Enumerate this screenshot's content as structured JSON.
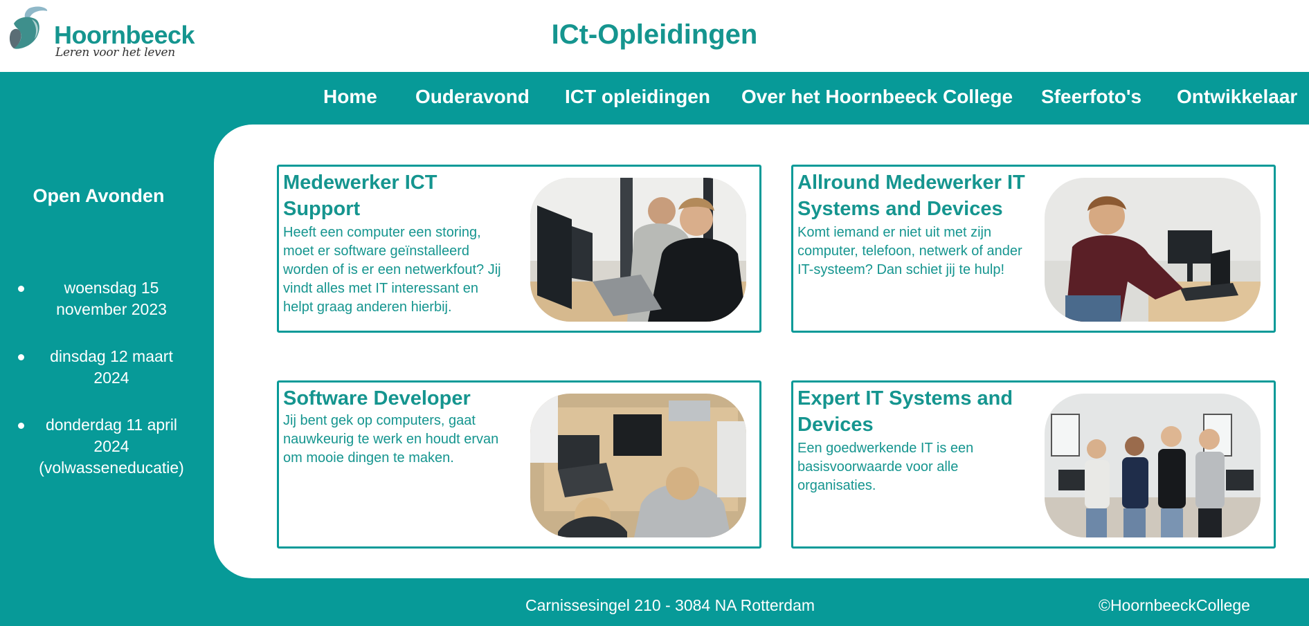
{
  "brand": {
    "name": "Hoornbeeck",
    "tagline": "Leren voor het leven",
    "accent_color": "#079a98",
    "heading_color": "#15958f"
  },
  "page_title": "ICt-Opleidingen",
  "nav": {
    "items": [
      {
        "label": "Home"
      },
      {
        "label": "Ouderavond"
      },
      {
        "label": "ICT opleidingen"
      },
      {
        "label": "Over het Hoornbeeck College"
      },
      {
        "label": "Sfeerfoto's"
      },
      {
        "label": "Ontwikkelaar"
      }
    ]
  },
  "sidebar": {
    "title": "Open Avonden",
    "dates": [
      {
        "label": "woensdag 15 november 2023"
      },
      {
        "label": "dinsdag 12 maart 2024"
      },
      {
        "label": "donderdag 11 april 2024 (volwasseneducatie)"
      }
    ]
  },
  "courses": [
    {
      "title": "Medewerker ICT Support",
      "description": "Heeft een computer een storing, moet er software geïnstalleerd worden of is er een netwerkfout? Jij vindt alles met IT interessant en helpt graag anderen hierbij.",
      "image_icon": "photo-students-at-computers"
    },
    {
      "title": "Allround Medewerker IT Systems and Devices",
      "description": "Komt iemand er niet uit met zijn computer, telefoon, netwerk of ander IT-systeem? Dan schiet jij te hulp!",
      "image_icon": "photo-student-at-laptop"
    },
    {
      "title": "Software Developer",
      "description": "Jij bent gek op computers, gaat nauwkeurig te werk en houdt ervan om mooie dingen te maken.",
      "image_icon": "photo-students-coding-at-table"
    },
    {
      "title": "Expert IT Systems and Devices",
      "description": "Een goedwerkende IT is een basisvoorwaarde voor alle organisaties.",
      "image_icon": "photo-group-of-students"
    }
  ],
  "footer": {
    "address": "Carnissesingel 210 - 3084 NA Rotterdam",
    "copyright": "©HoornbeeckCollege"
  }
}
